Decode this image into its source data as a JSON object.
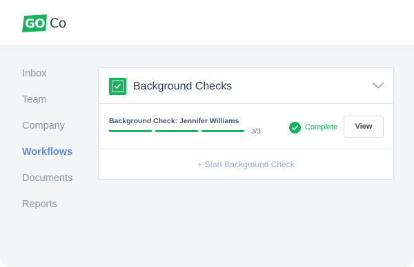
{
  "logo": {
    "text_go": "GO",
    "text_co": "Co",
    "accent_color": "#15b45c"
  },
  "sidebar": {
    "items": [
      {
        "label": "Inbox",
        "active": false
      },
      {
        "label": "Team",
        "active": false
      },
      {
        "label": "Company",
        "active": false
      },
      {
        "label": "Workflows",
        "active": true
      },
      {
        "label": "Documents",
        "active": false
      },
      {
        "label": "Reports",
        "active": false
      }
    ]
  },
  "card": {
    "title": "Background Checks",
    "row": {
      "title": "Background Check: Jennifer Williams",
      "progress_completed": 3,
      "progress_total": 3,
      "progress_label": "3/3",
      "status": "Complete",
      "status_color": "#15b45c",
      "view_label": "View"
    },
    "start_label": "+ Start Background Check"
  },
  "icons": {
    "checkbox": "checkbox-checked-icon",
    "chevron": "chevron-down-icon",
    "status": "check-circle-icon"
  }
}
